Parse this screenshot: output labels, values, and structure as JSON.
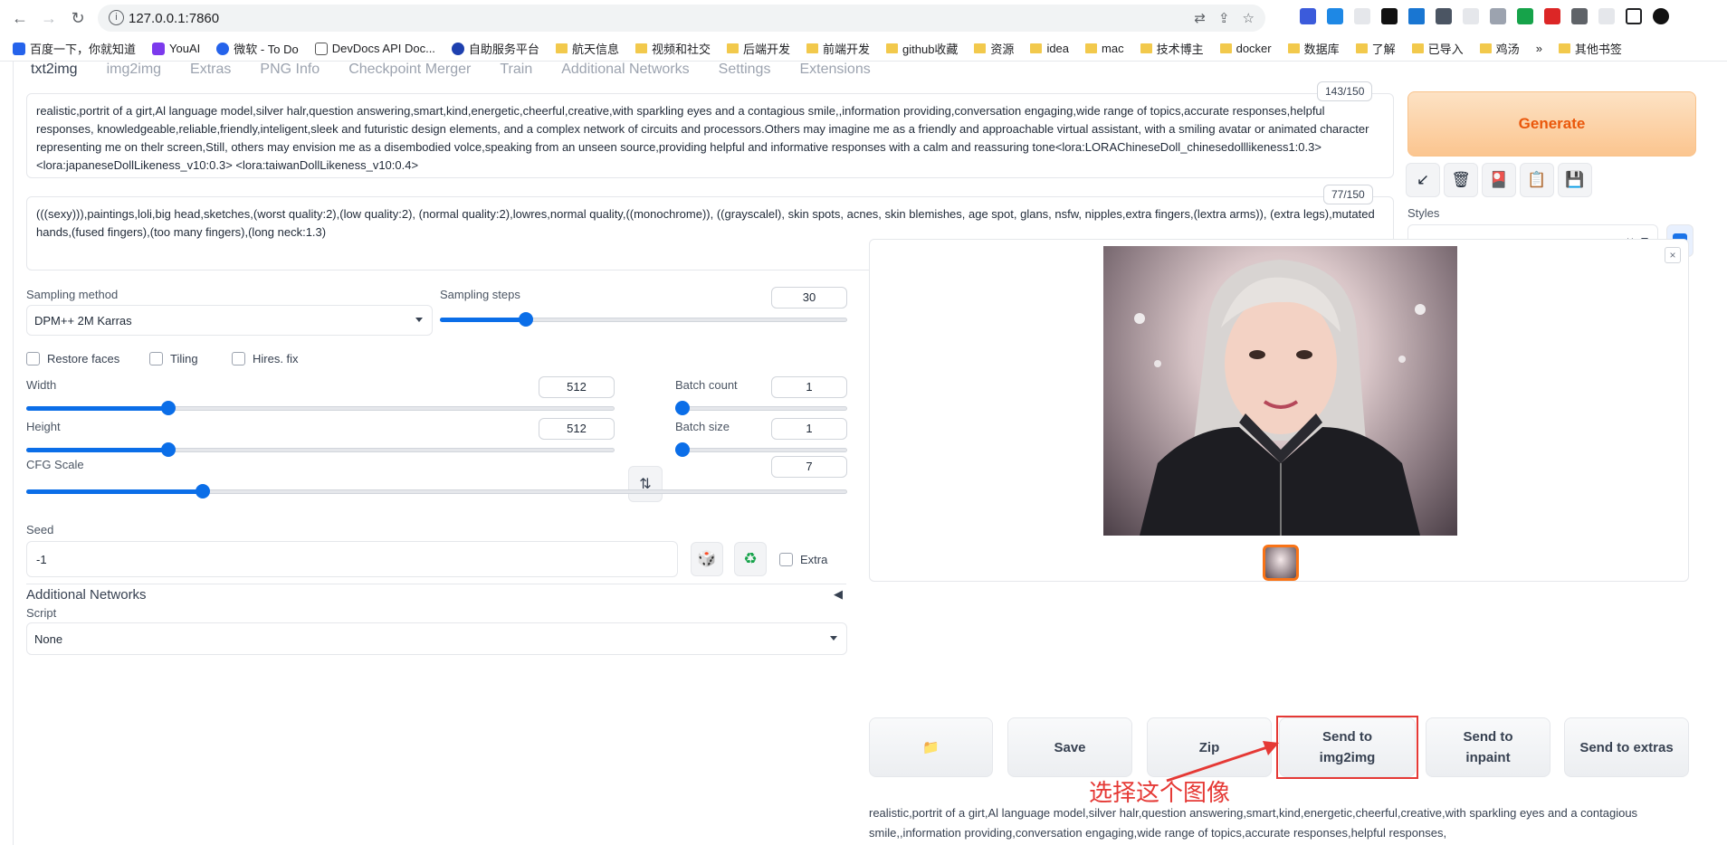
{
  "browser": {
    "url": "127.0.0.1:7860",
    "bookmarks": [
      "百度一下，你就知道",
      "YouAI",
      "微软 - To Do",
      "DevDocs API Doc...",
      "自助服务平台",
      "航天信息",
      "视频和社交",
      "后端开发",
      "前端开发",
      "github收藏",
      "资源",
      "idea",
      "mac",
      "技术博主",
      "docker",
      "数据库",
      "了解",
      "已导入",
      "鸡汤",
      "其他书签"
    ],
    "more": "»"
  },
  "tabs": [
    "txt2img",
    "img2img",
    "Extras",
    "PNG Info",
    "Checkpoint Merger",
    "Train",
    "Additional Networks",
    "Settings",
    "Extensions"
  ],
  "prompt": {
    "text": "realistic,portrit of a girt,Al language model,silver halr,question answering,smart,kind,energetic,cheerful,creative,with sparkling eyes and a contagious smile,,information providing,conversation engaging,wide range of topics,accurate responses,helpful responses, knowledgeable,reliable,friendly,inteligent,sleek and futuristic design elements, and a complex network of circuits and processors.Others may imagine me as a friendly and approachable virtual assistant, with a smiling avatar or animated character representing me on thelr screen,Still, others may envision me as a disembodied volce,speaking from an unseen source,providing helpful and informative responses with a calm and reassuring tone<lora:LORAChineseDoll_chinesedolllikeness1:0.3> <lora:japaneseDollLikeness_v10:0.3> <lora:taiwanDollLikeness_v10:0.4>",
    "counter": "143/150"
  },
  "negative": {
    "text": "(((sexy))),paintings,loli,big head,sketches,(worst quality:2),(low quality:2), (normal quality:2),lowres,normal quality,((monochrome)), ((grayscalel), skin spots, acnes, skin blemishes, age spot, glans, nsfw, nipples,extra fingers,(lextra arms)), (extra legs),mutated hands,(fused fingers),(too many fingers),(long neck:1.3)",
    "counter": "77/150"
  },
  "generate_label": "Generate",
  "styles": {
    "label": "Styles",
    "value": "",
    "clear": "×"
  },
  "sampling": {
    "method_label": "Sampling method",
    "method": "DPM++ 2M Karras",
    "steps_label": "Sampling steps",
    "steps": "30",
    "steps_frac": 0.2
  },
  "checks": {
    "restore": "Restore faces",
    "tiling": "Tiling",
    "hires": "Hires. fix",
    "extra": "Extra"
  },
  "width": {
    "label": "Width",
    "value": "512",
    "frac": 0.235
  },
  "height": {
    "label": "Height",
    "value": "512",
    "frac": 0.235
  },
  "batch_count": {
    "label": "Batch count",
    "value": "1",
    "frac": 0
  },
  "batch_size": {
    "label": "Batch size",
    "value": "1",
    "frac": 0
  },
  "cfg": {
    "label": "CFG Scale",
    "value": "7",
    "frac": 0.21
  },
  "seed": {
    "label": "Seed",
    "value": "-1"
  },
  "additional_networks": {
    "label": "Additional Networks",
    "arrow": "◀"
  },
  "script": {
    "label": "Script",
    "value": "None"
  },
  "actions": {
    "folder": "📁",
    "save": "Save",
    "zip": "Zip",
    "send_img2img_1": "Send to",
    "send_img2img_2": "img2img",
    "send_inpaint_1": "Send to",
    "send_inpaint_2": "inpaint",
    "send_extras": "Send to extras"
  },
  "annotation": "选择这个图像",
  "info_text": "realistic,portrit of a girt,Al language model,silver halr,question answering,smart,kind,energetic,cheerful,creative,with sparkling eyes and a contagious smile,,information providing,conversation engaging,wide range of topics,accurate responses,helpful responses,",
  "colors": {
    "accent": "#0b6ee8",
    "generate": "#ea580c",
    "annotation": "#e53935"
  }
}
